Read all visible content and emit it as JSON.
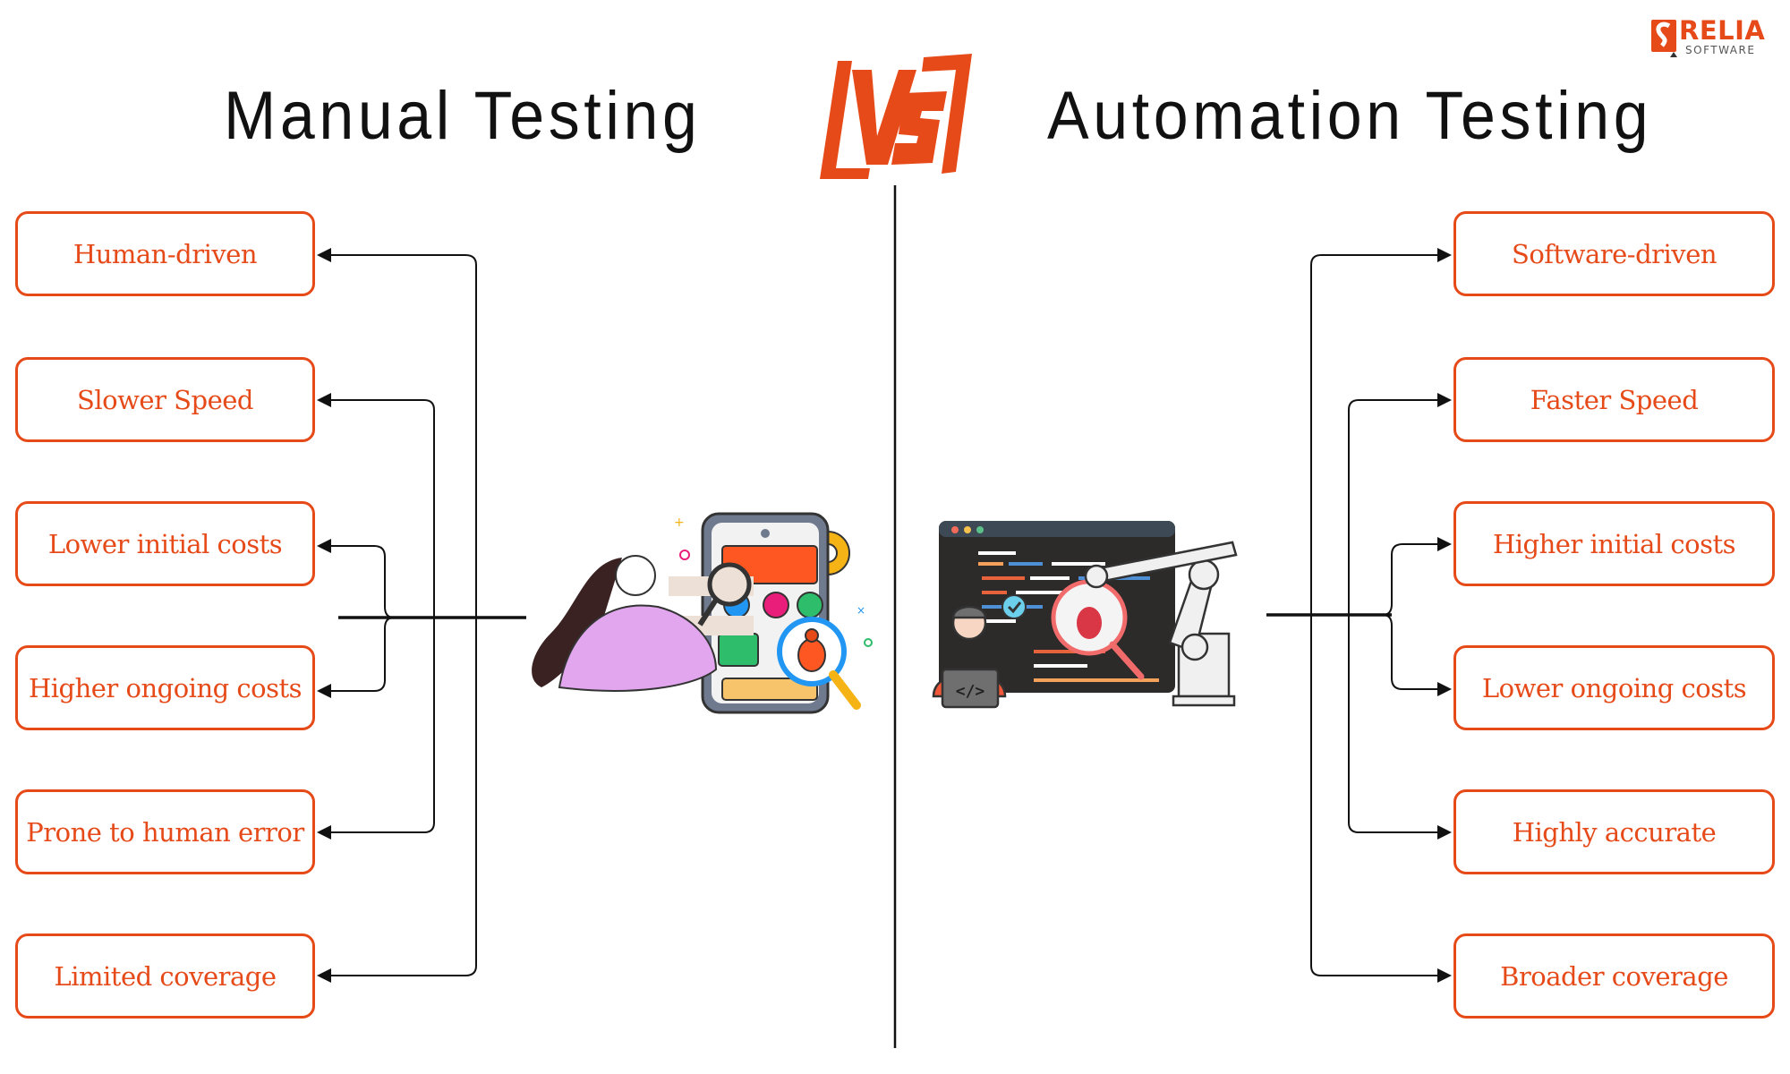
{
  "brand": {
    "name": "RELIA",
    "subtitle": "SOFTWARE",
    "color": "#e64a19"
  },
  "comparison": {
    "left_title": "Manual Testing",
    "vs_label": "VS",
    "right_title": "Automation Testing"
  },
  "manual_features": [
    {
      "label": "Human-driven"
    },
    {
      "label": "Slower Speed"
    },
    {
      "label": "Lower initial costs"
    },
    {
      "label": "Higher ongoing costs"
    },
    {
      "label": "Prone to human error"
    },
    {
      "label": "Limited coverage"
    }
  ],
  "automation_features": [
    {
      "label": "Software-driven"
    },
    {
      "label": "Faster Speed"
    },
    {
      "label": "Higher initial costs"
    },
    {
      "label": "Lower ongoing costs"
    },
    {
      "label": "Highly accurate"
    },
    {
      "label": "Broader coverage"
    }
  ],
  "illustrations": {
    "left": "woman-inspecting-phone-for-bugs-illustration",
    "right": "developer-code-window-robot-arm-illustration"
  },
  "colors": {
    "accent": "#e64a19",
    "text_dark": "#111111",
    "connector": "#111111"
  }
}
